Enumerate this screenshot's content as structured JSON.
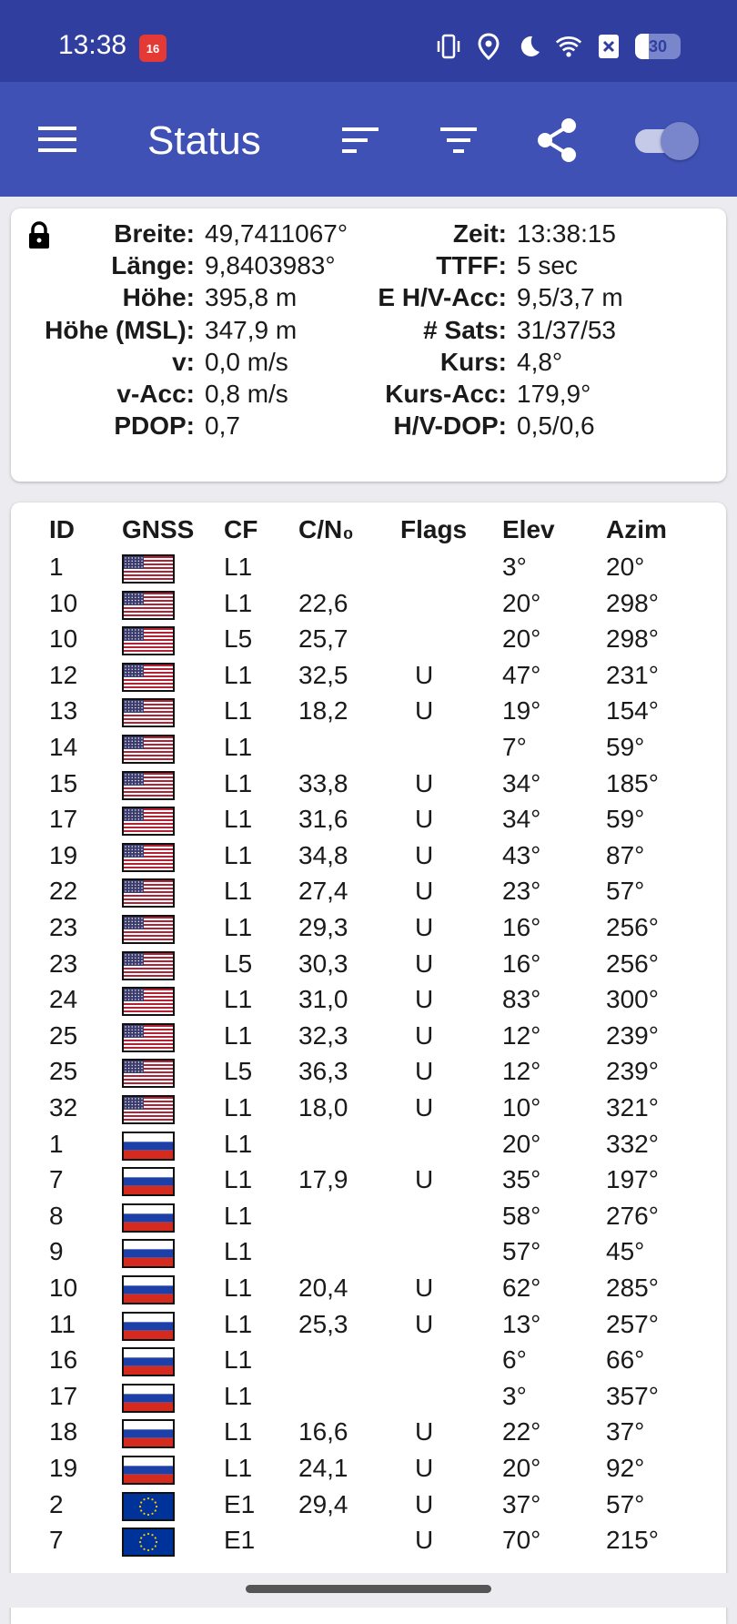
{
  "status_bar": {
    "time": "13:38",
    "notification_badge": "16",
    "battery": "30",
    "battery_level": 0.3
  },
  "app_bar": {
    "title": "Status"
  },
  "fix": {
    "rows": [
      {
        "k1": "Breite:",
        "v1": "49,7411067°",
        "k2": "Zeit:",
        "v2": "13:38:15"
      },
      {
        "k1": "Länge:",
        "v1": "9,8403983°",
        "k2": "TTFF:",
        "v2": "5 sec"
      },
      {
        "k1": "Höhe:",
        "v1": "395,8 m",
        "k2": "E H/V-Acc:",
        "v2": "9,5/3,7 m"
      },
      {
        "k1": "Höhe (MSL):",
        "v1": "347,9 m",
        "k2": "# Sats:",
        "v2": "31/37/53"
      },
      {
        "k1": "v:",
        "v1": "0,0 m/s",
        "k2": "Kurs:",
        "v2": "4,8°"
      },
      {
        "k1": "v-Acc:",
        "v1": "0,8 m/s",
        "k2": "Kurs-Acc:",
        "v2": "179,9°"
      },
      {
        "k1": "PDOP:",
        "v1": "0,7",
        "k2": "H/V-DOP:",
        "v2": "0,5/0,6"
      }
    ]
  },
  "table": {
    "headers": {
      "id": "ID",
      "gnss": "GNSS",
      "cf": "CF",
      "cn0": "C/N₀",
      "flags": "Flags",
      "elev": "Elev",
      "azim": "Azim"
    },
    "rows": [
      {
        "id": "1",
        "gnss": "us-flag",
        "cf": "L1",
        "cn0": "",
        "flags": "",
        "elev": "3°",
        "azim": "20°"
      },
      {
        "id": "10",
        "gnss": "us-flag",
        "cf": "L1",
        "cn0": "22,6",
        "flags": "",
        "elev": "20°",
        "azim": "298°"
      },
      {
        "id": "10",
        "gnss": "us-flag",
        "cf": "L5",
        "cn0": "25,7",
        "flags": "",
        "elev": "20°",
        "azim": "298°"
      },
      {
        "id": "12",
        "gnss": "us-flag",
        "cf": "L1",
        "cn0": "32,5",
        "flags": "U",
        "elev": "47°",
        "azim": "231°"
      },
      {
        "id": "13",
        "gnss": "us-flag",
        "cf": "L1",
        "cn0": "18,2",
        "flags": "U",
        "elev": "19°",
        "azim": "154°"
      },
      {
        "id": "14",
        "gnss": "us-flag",
        "cf": "L1",
        "cn0": "",
        "flags": "",
        "elev": "7°",
        "azim": "59°"
      },
      {
        "id": "15",
        "gnss": "us-flag",
        "cf": "L1",
        "cn0": "33,8",
        "flags": "U",
        "elev": "34°",
        "azim": "185°"
      },
      {
        "id": "17",
        "gnss": "us-flag",
        "cf": "L1",
        "cn0": "31,6",
        "flags": "U",
        "elev": "34°",
        "azim": "59°"
      },
      {
        "id": "19",
        "gnss": "us-flag",
        "cf": "L1",
        "cn0": "34,8",
        "flags": "U",
        "elev": "43°",
        "azim": "87°"
      },
      {
        "id": "22",
        "gnss": "us-flag",
        "cf": "L1",
        "cn0": "27,4",
        "flags": "U",
        "elev": "23°",
        "azim": "57°"
      },
      {
        "id": "23",
        "gnss": "us-flag",
        "cf": "L1",
        "cn0": "29,3",
        "flags": "U",
        "elev": "16°",
        "azim": "256°"
      },
      {
        "id": "23",
        "gnss": "us-flag",
        "cf": "L5",
        "cn0": "30,3",
        "flags": "U",
        "elev": "16°",
        "azim": "256°"
      },
      {
        "id": "24",
        "gnss": "us-flag",
        "cf": "L1",
        "cn0": "31,0",
        "flags": "U",
        "elev": "83°",
        "azim": "300°"
      },
      {
        "id": "25",
        "gnss": "us-flag",
        "cf": "L1",
        "cn0": "32,3",
        "flags": "U",
        "elev": "12°",
        "azim": "239°"
      },
      {
        "id": "25",
        "gnss": "us-flag",
        "cf": "L5",
        "cn0": "36,3",
        "flags": "U",
        "elev": "12°",
        "azim": "239°"
      },
      {
        "id": "32",
        "gnss": "us-flag",
        "cf": "L1",
        "cn0": "18,0",
        "flags": "U",
        "elev": "10°",
        "azim": "321°"
      },
      {
        "id": "1",
        "gnss": "ru-flag",
        "cf": "L1",
        "cn0": "",
        "flags": "",
        "elev": "20°",
        "azim": "332°"
      },
      {
        "id": "7",
        "gnss": "ru-flag",
        "cf": "L1",
        "cn0": "17,9",
        "flags": "U",
        "elev": "35°",
        "azim": "197°"
      },
      {
        "id": "8",
        "gnss": "ru-flag",
        "cf": "L1",
        "cn0": "",
        "flags": "",
        "elev": "58°",
        "azim": "276°"
      },
      {
        "id": "9",
        "gnss": "ru-flag",
        "cf": "L1",
        "cn0": "",
        "flags": "",
        "elev": "57°",
        "azim": "45°"
      },
      {
        "id": "10",
        "gnss": "ru-flag",
        "cf": "L1",
        "cn0": "20,4",
        "flags": "U",
        "elev": "62°",
        "azim": "285°"
      },
      {
        "id": "11",
        "gnss": "ru-flag",
        "cf": "L1",
        "cn0": "25,3",
        "flags": "U",
        "elev": "13°",
        "azim": "257°"
      },
      {
        "id": "16",
        "gnss": "ru-flag",
        "cf": "L1",
        "cn0": "",
        "flags": "",
        "elev": "6°",
        "azim": "66°"
      },
      {
        "id": "17",
        "gnss": "ru-flag",
        "cf": "L1",
        "cn0": "",
        "flags": "",
        "elev": "3°",
        "azim": "357°"
      },
      {
        "id": "18",
        "gnss": "ru-flag",
        "cf": "L1",
        "cn0": "16,6",
        "flags": "U",
        "elev": "22°",
        "azim": "37°"
      },
      {
        "id": "19",
        "gnss": "ru-flag",
        "cf": "L1",
        "cn0": "24,1",
        "flags": "U",
        "elev": "20°",
        "azim": "92°"
      },
      {
        "id": "2",
        "gnss": "eu-flag",
        "cf": "E1",
        "cn0": "29,4",
        "flags": "U",
        "elev": "37°",
        "azim": "57°"
      },
      {
        "id": "7",
        "gnss": "eu-flag",
        "cf": "E1",
        "cn0": "",
        "flags": "U",
        "elev": "70°",
        "azim": "215°"
      }
    ]
  },
  "colors": {
    "status_bar": "#303f9f",
    "app_bar": "#3f51b5",
    "background": "#ebebf0"
  }
}
